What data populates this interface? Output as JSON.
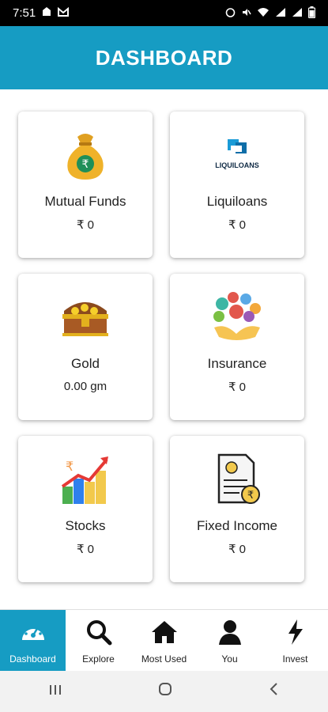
{
  "status_bar": {
    "time": "7:51",
    "battery_percent_text": ""
  },
  "header": {
    "title": "DASHBOARD"
  },
  "cards": [
    {
      "title": "Mutual Funds",
      "value": "₹ 0",
      "icon": "money-bag-icon"
    },
    {
      "title": "Liquiloans",
      "value": "₹ 0",
      "icon": "liquiloans-logo",
      "logo_text": "LIQUILOANS"
    },
    {
      "title": "Gold",
      "value": "0.00 gm",
      "icon": "treasure-chest-icon"
    },
    {
      "title": "Insurance",
      "value": "₹ 0",
      "icon": "insurance-hands-icon"
    },
    {
      "title": "Stocks",
      "value": "₹ 0",
      "icon": "stocks-chart-icon"
    },
    {
      "title": "Fixed Income",
      "value": "₹ 0",
      "icon": "fixed-income-document-icon"
    }
  ],
  "bottom_nav": [
    {
      "label": "Dashboard",
      "icon": "speedometer-icon",
      "active": true
    },
    {
      "label": "Explore",
      "icon": "search-icon",
      "active": false
    },
    {
      "label": "Most Used",
      "icon": "home-icon",
      "active": false
    },
    {
      "label": "You",
      "icon": "user-icon",
      "active": false
    },
    {
      "label": "Invest",
      "icon": "lightning-icon",
      "active": false
    }
  ],
  "colors": {
    "primary": "#169cc3",
    "card_bg": "#ffffff",
    "text": "#222222"
  }
}
